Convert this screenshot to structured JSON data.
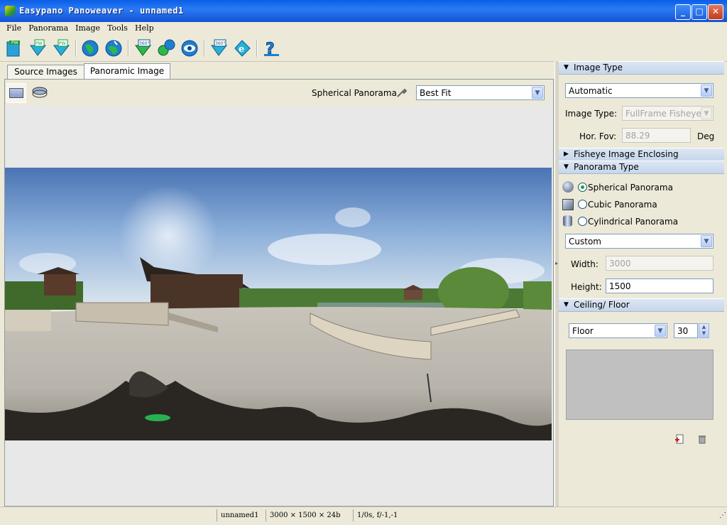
{
  "window": {
    "title": "Easypano Panoweaver - unnamed1"
  },
  "menu": [
    "File",
    "Panorama",
    "Image",
    "Tools",
    "Help"
  ],
  "toolbar_icons": [
    "new-project-icon",
    "open-pw-icon",
    "save-pw-icon",
    "stitch-icon",
    "auto-stitch-icon",
    "publish-360-icon",
    "blend-icon",
    "preview-icon",
    "export-360-icon",
    "ie-preview-icon",
    "help-icon"
  ],
  "tabs": {
    "source": "Source Images",
    "panoramic": "Panoramic Image"
  },
  "view": {
    "panorama_type": "Spherical Panorama",
    "fit": "Best Fit"
  },
  "right": {
    "image_type_header": "Image Type",
    "image_type_mode": "Automatic",
    "image_type_label": "Image Type:",
    "image_type_value": "FullFrame Fisheye",
    "hor_fov_label": "Hor. Fov:",
    "hor_fov_value": "88.29",
    "deg": "Deg",
    "fisheye_header": "Fisheye Image Enclosing",
    "pano_type_header": "Panorama Type",
    "spherical": "Spherical Panorama",
    "cubic": "Cubic Panorama",
    "cylindrical": "Cylindrical Panorama",
    "size_mode": "Custom",
    "width_label": "Width:",
    "width_value": "3000",
    "height_label": "Height:",
    "height_value": "1500",
    "ceiling_header": "Ceiling/ Floor",
    "cf_mode": "Floor",
    "cf_value": "30"
  },
  "status": {
    "name": "unnamed1",
    "size": "3000 × 1500 × 24b",
    "exif": "1/0s, f/-1,-1"
  }
}
